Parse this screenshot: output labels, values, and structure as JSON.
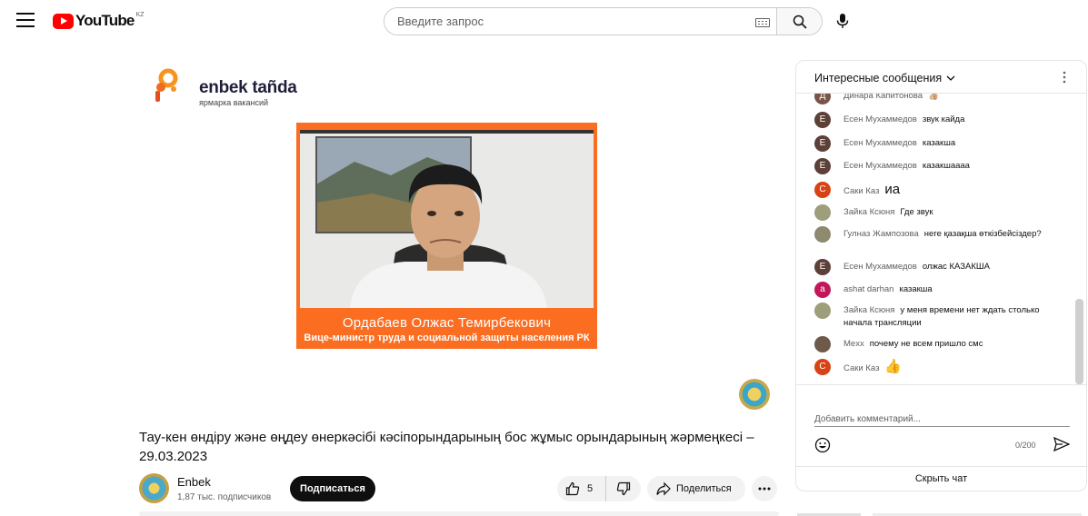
{
  "header": {
    "logo_text": "YouTube",
    "country_code": "KZ",
    "search_placeholder": "Введите запрос"
  },
  "video": {
    "brand_name": "enbek tañda",
    "brand_sub": "ярмарка вакансий",
    "speaker_name": "Ордабаев Олжас Темирбекович",
    "speaker_title": "Вице-министр труда и социальной защиты населения РК",
    "title": "Тау-кен өндіру және өңдеу өнеркәсібі кәсіпорындарының бос жұмыс орындарының жәрмеңкесі – 29.03.2023"
  },
  "channel": {
    "name": "Enbek",
    "subscribers": "1,87 тыс. подписчиков",
    "subscribe_label": "Подписаться"
  },
  "actions": {
    "like_count": "5",
    "share_label": "Поделиться"
  },
  "chat": {
    "mode_label": "Интересные сообщения",
    "messages": [
      {
        "author": "Динара Капитонова",
        "text": "👍🏼",
        "initial": "Д",
        "color": "#795548"
      },
      {
        "author": "Есен Мухаммедов",
        "text": "звук кайда",
        "initial": "Е",
        "color": "#5d4037"
      },
      {
        "author": "Есен Мухаммедов",
        "text": "казакша",
        "initial": "Е",
        "color": "#5d4037"
      },
      {
        "author": "Есен Мухаммедов",
        "text": "казакшаааа",
        "initial": "Е",
        "color": "#5d4037"
      },
      {
        "author": "Саки Каз",
        "text": "иа",
        "initial": "С",
        "color": "#d84315"
      },
      {
        "author": "Зайка Ксюня",
        "text": "Где звук",
        "initial": "",
        "color": "#9e9e7a"
      },
      {
        "author": "Гулназ Жампозова",
        "text": "неге қазақша өткізбейсіздер?",
        "initial": "",
        "color": "#8d8a6d"
      },
      {
        "author": "Есен Мухаммедов",
        "text": "олжас КАЗАКША",
        "initial": "Е",
        "color": "#5d4037"
      },
      {
        "author": "ashat darhan",
        "text": "казакша",
        "initial": "a",
        "color": "#c2185b"
      },
      {
        "author": "Зайка Ксюня",
        "text": "у меня времени нет ждать столько начала трансляции",
        "initial": "",
        "color": "#9e9e7a"
      },
      {
        "author": "Mexx",
        "text": "почему не всем пришло смс",
        "initial": "",
        "color": "#6d5a4a"
      },
      {
        "author": "Саки Каз",
        "text": "👍",
        "initial": "С",
        "color": "#d84315"
      }
    ],
    "comment_placeholder": "Добавить комментарий...",
    "counter": "0/200",
    "hide_label": "Скрыть чат"
  }
}
